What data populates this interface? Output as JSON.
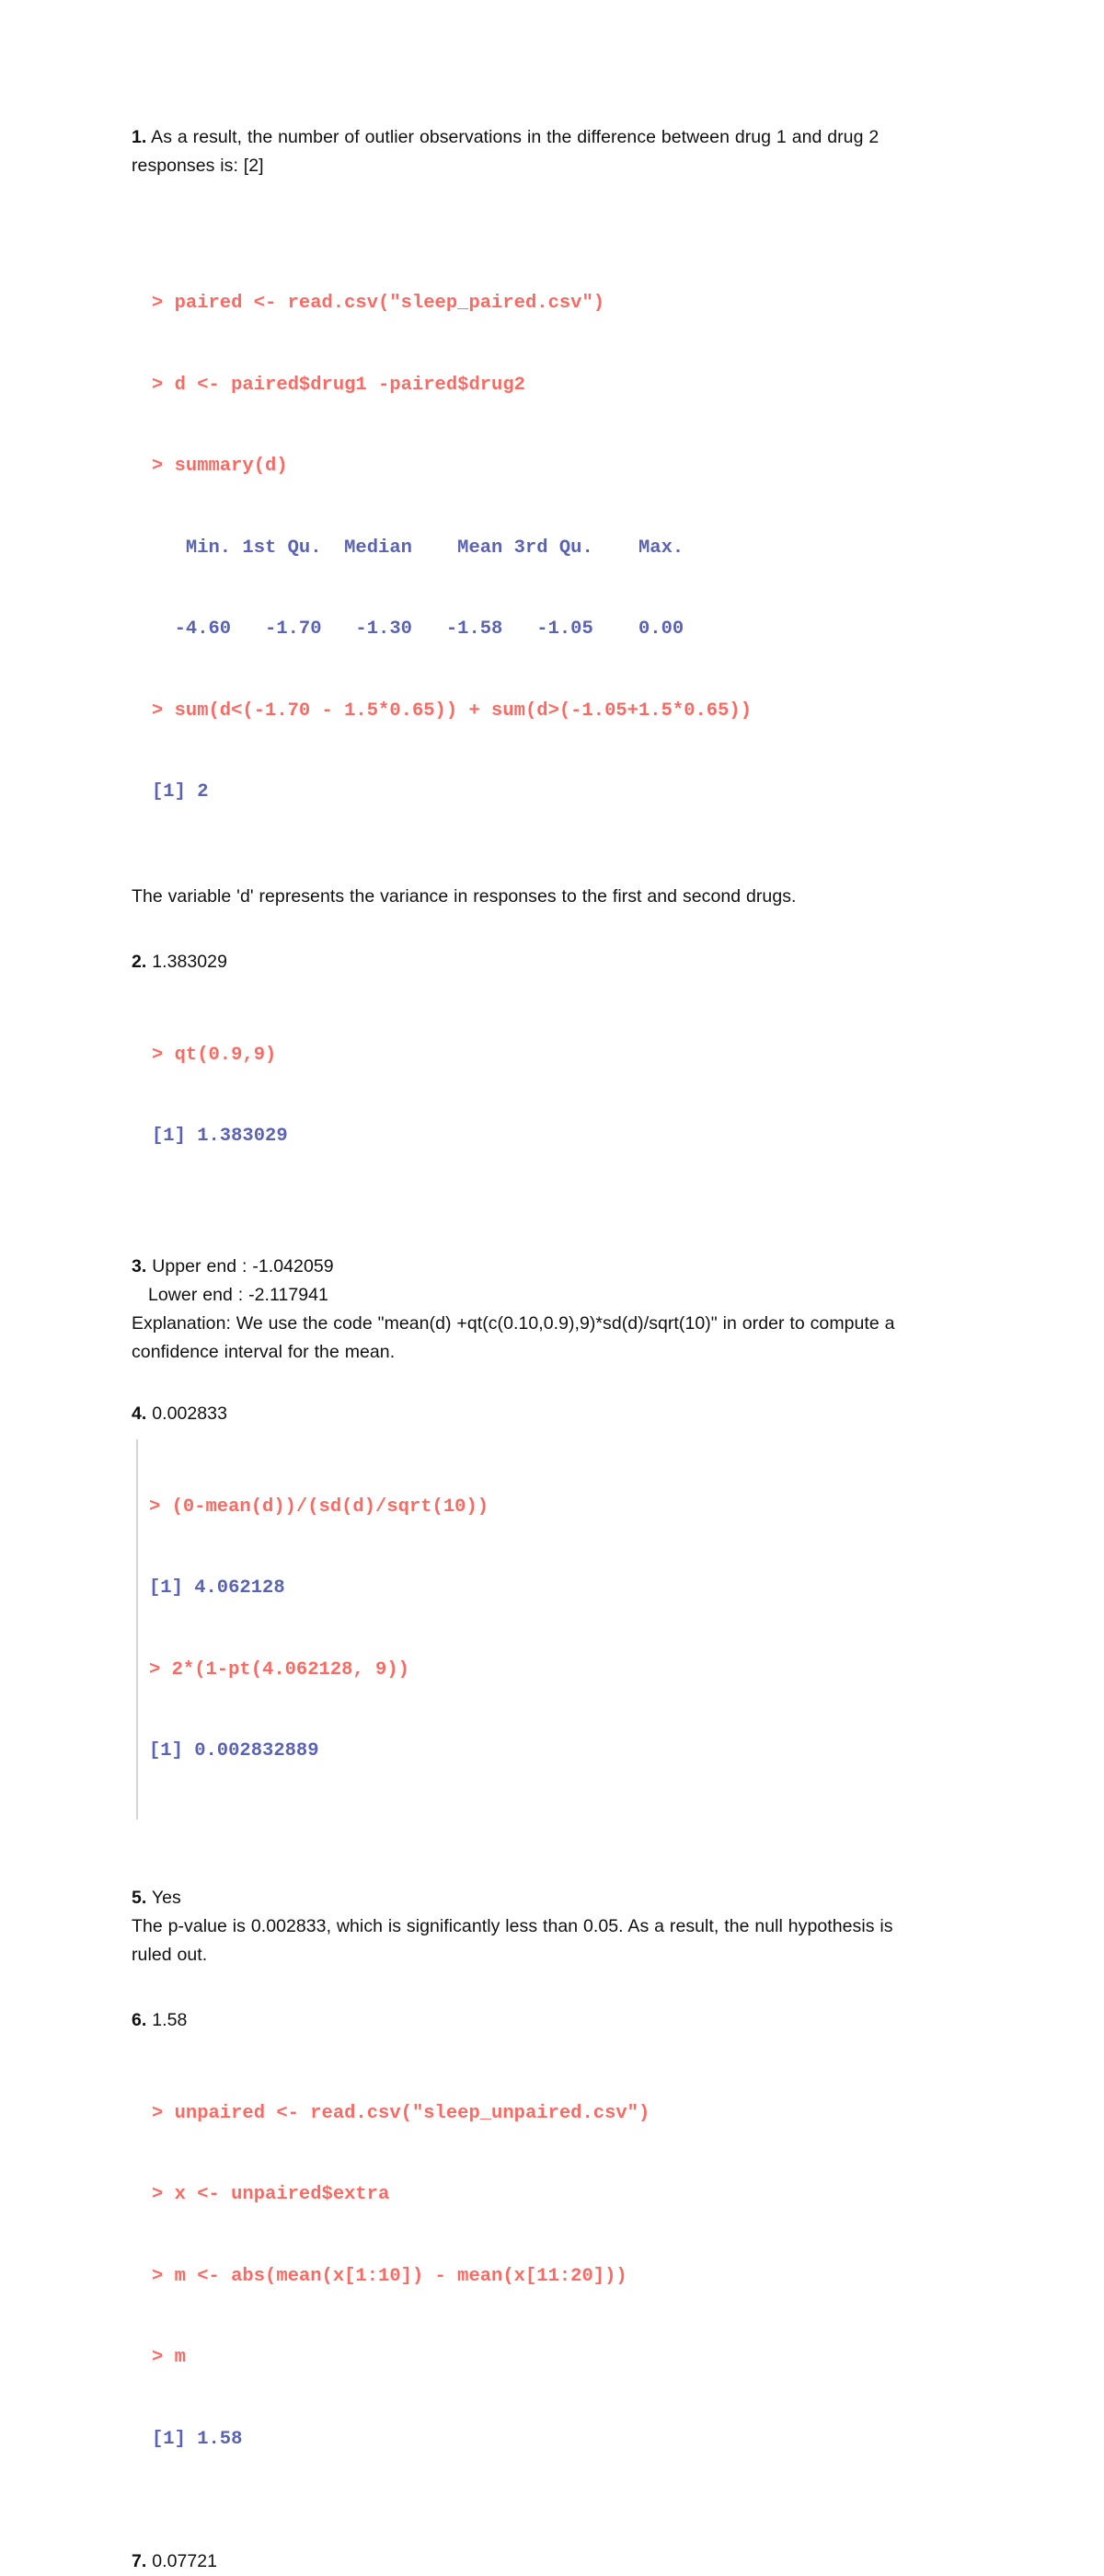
{
  "document": {
    "type": "r-statistics-homework-answers",
    "page_background": "#ffffff",
    "body_text_color": "#111111",
    "console_command_color": "#fa6a62",
    "console_output_color": "#5a62b4",
    "code_border_color": "#d4d4d4"
  },
  "q1": {
    "marker": "1.",
    "line1": " As a result, the number of outlier observations in the difference between drug 1 and drug 2",
    "line2": "responses is: [2]",
    "code": [
      {
        "kind": "cmd",
        "text": "> paired <- read.csv(\"sleep_paired.csv\")"
      },
      {
        "kind": "cmd",
        "text": "> d <- paired$drug1 -paired$drug2"
      },
      {
        "kind": "cmd",
        "text": "> summary(d)"
      },
      {
        "kind": "out",
        "text": "   Min. 1st Qu.  Median    Mean 3rd Qu.    Max."
      },
      {
        "kind": "out",
        "text": "  -4.60   -1.70   -1.30   -1.58   -1.05    0.00"
      },
      {
        "kind": "cmd",
        "text": "> sum(d<(-1.70 - 1.5*0.65)) + sum(d>(-1.05+1.5*0.65))"
      },
      {
        "kind": "out",
        "text": "[1] 2"
      }
    ],
    "explanation": "The variable 'd' represents the variance in responses to the first and second drugs."
  },
  "q2": {
    "marker": "2.",
    "answer": " 1.383029",
    "code": [
      {
        "kind": "cmd",
        "text": "> qt(0.9,9)"
      },
      {
        "kind": "out",
        "text": "[1] 1.383029"
      }
    ]
  },
  "q3": {
    "marker": "3.",
    "upper": " Upper end : -1.042059",
    "lower": "Lower end : -2.117941",
    "explanation_line1": "Explanation: We use the code \"mean(d) +qt(c(0.10,0.9),9)*sd(d)/sqrt(10)\" in order to compute a",
    "explanation_line2": "confidence interval for the mean."
  },
  "q4": {
    "marker": "4.",
    "answer": " 0.002833",
    "code": [
      {
        "kind": "cmd",
        "text": "> (0-mean(d))/(sd(d)/sqrt(10))"
      },
      {
        "kind": "out",
        "text": "[1] 4.062128"
      },
      {
        "kind": "cmd",
        "text": "> 2*(1-pt(4.062128, 9))"
      },
      {
        "kind": "out",
        "text": "[1] 0.002832889"
      }
    ]
  },
  "q5": {
    "marker": "5.",
    "answer": " Yes",
    "explanation_line1": "The p-value is 0.002833, which is significantly less than 0.05. As a result, the null hypothesis is",
    "explanation_line2": "ruled out."
  },
  "q6": {
    "marker": "6.",
    "answer": " 1.58",
    "code": [
      {
        "kind": "cmd",
        "text": "> unpaired <- read.csv(\"sleep_unpaired.csv\")"
      },
      {
        "kind": "cmd",
        "text": "> x <- unpaired$extra"
      },
      {
        "kind": "cmd",
        "text": "> m <- abs(mean(x[1:10]) - mean(x[11:20]))"
      },
      {
        "kind": "cmd",
        "text": "> m"
      },
      {
        "kind": "out",
        "text": "[1] 1.58"
      }
    ]
  },
  "q7": {
    "marker": "7.",
    "answer": " 0.07721"
  }
}
